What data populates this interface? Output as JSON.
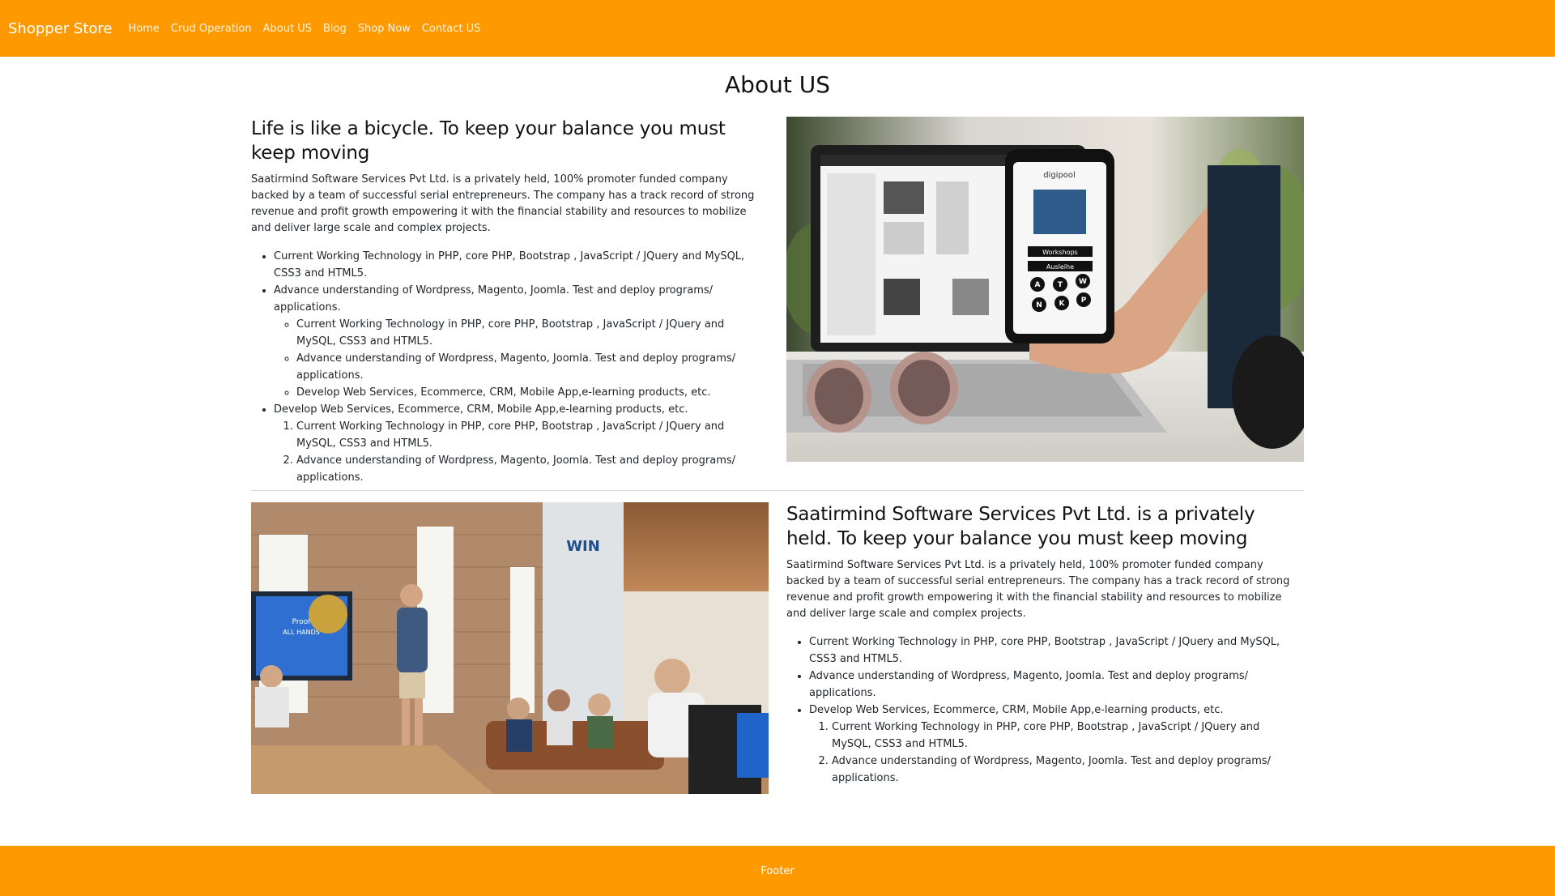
{
  "navbar": {
    "brand": "Shopper Store",
    "links": [
      "Home",
      "Crud Operation",
      "About US",
      "Blog",
      "Shop Now",
      "Contact US"
    ]
  },
  "page": {
    "title": "About US"
  },
  "section1": {
    "heading": "Life is like a bicycle. To keep your balance you must keep moving",
    "paragraph": "Saatirmind Software Services Pvt Ltd. is a privately held, 100% promoter funded company backed by a team of successful serial entrepreneurs. The company has a track record of strong revenue and profit growth empowering it with the financial stability and resources to mobilize and deliver large scale and complex projects.",
    "list": [
      "Current Working Technology in PHP, core PHP, Bootstrap , JavaScript / JQuery and MySQL, CSS3 and HTML5.",
      "Advance understanding of Wordpress, Magento, Joomla. Test and deploy programs/ applications.",
      "Develop Web Services, Ecommerce, CRM, Mobile App,e-learning products, etc."
    ],
    "sublist_circle": [
      "Current Working Technology in PHP, core PHP, Bootstrap , JavaScript / JQuery and MySQL, CSS3 and HTML5.",
      "Advance understanding of Wordpress, Magento, Joomla. Test and deploy programs/ applications.",
      "Develop Web Services, Ecommerce, CRM, Mobile App,e-learning products, etc."
    ],
    "sublist_ordered": [
      "Current Working Technology in PHP, core PHP, Bootstrap , JavaScript / JQuery and MySQL, CSS3 and HTML5.",
      "Advance understanding of Wordpress, Magento, Joomla. Test and deploy programs/ applications."
    ],
    "image": {
      "phone_title": "digipool",
      "phone_btn1": "Workshops",
      "phone_btn2": "Ausleihe",
      "phone_letters": [
        "A",
        "T",
        "W",
        "N",
        "K",
        "P"
      ]
    }
  },
  "section2": {
    "heading": "Saatirmind Software Services Pvt Ltd. is a privately held. To keep your balance you must keep moving",
    "paragraph": "Saatirmind Software Services Pvt Ltd. is a privately held, 100% promoter funded company backed by a team of successful serial entrepreneurs. The company has a track record of strong revenue and profit growth empowering it with the financial stability and resources to mobilize and deliver large scale and complex projects.",
    "list": [
      "Current Working Technology in PHP, core PHP, Bootstrap , JavaScript / JQuery and MySQL, CSS3 and HTML5.",
      "Advance understanding of Wordpress, Magento, Joomla. Test and deploy programs/ applications.",
      "Develop Web Services, Ecommerce, CRM, Mobile App,e-learning products, etc."
    ],
    "sublist_ordered": [
      "Current Working Technology in PHP, core PHP, Bootstrap , JavaScript / JQuery and MySQL, CSS3 and HTML5.",
      "Advance understanding of Wordpress, Magento, Joomla. Test and deploy programs/ applications."
    ],
    "image": {
      "wall_sign": "WIN",
      "screen_line1": "Proof",
      "screen_line2": "ALL HANDS"
    }
  },
  "footer": {
    "text": "Footer"
  },
  "colors": {
    "accent": "#ff9900",
    "nav_text": "#fff3e0",
    "divider": "#d6d6d6"
  }
}
